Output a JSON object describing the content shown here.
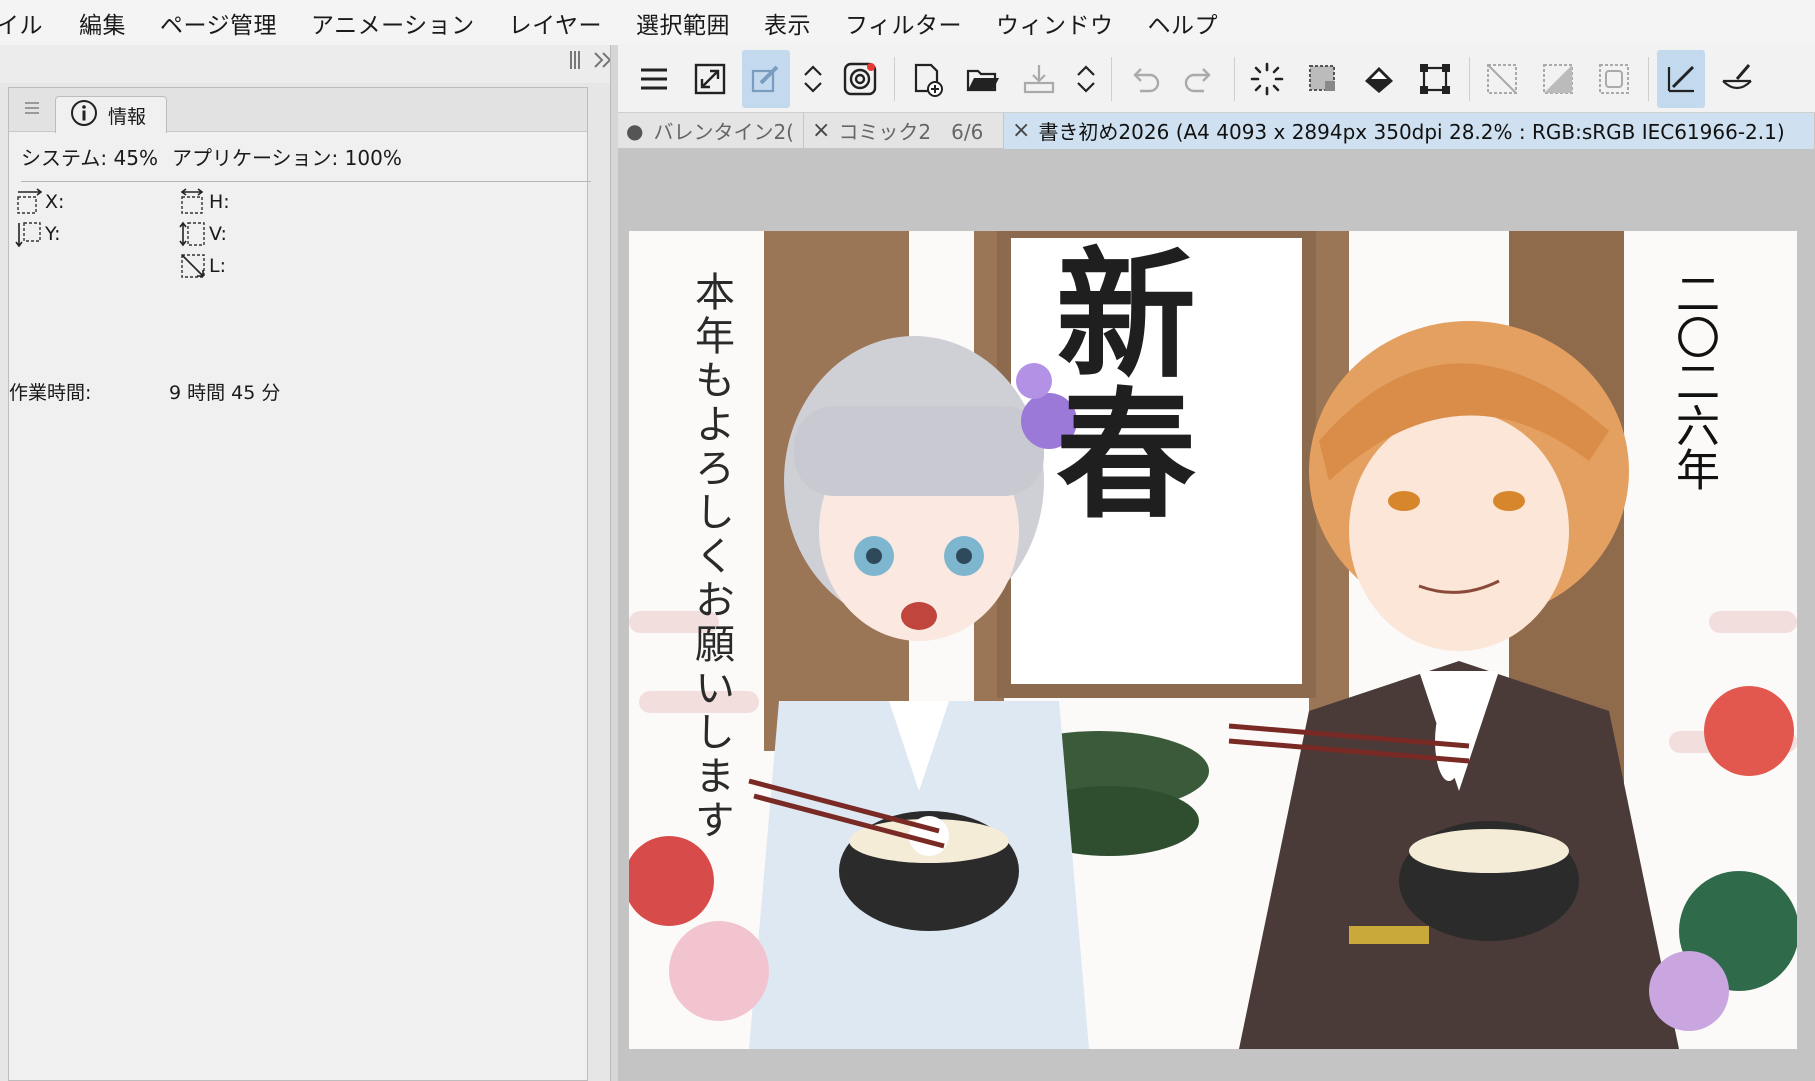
{
  "menu": {
    "items": [
      "イル",
      "編集",
      "ページ管理",
      "アニメーション",
      "レイヤー",
      "選択範囲",
      "表示",
      "フィルター",
      "ウィンドウ",
      "ヘルプ"
    ]
  },
  "info_panel": {
    "tab_label": "情報",
    "system_usage": "システム: 45%",
    "app_usage": "アプリケーション: 100%",
    "x_label": "X:",
    "y_label": "Y:",
    "h_label": "H:",
    "v_label": "V:",
    "l_label": "L:",
    "work_time_label": "作業時間:",
    "work_time_value": "9 時間 45 分"
  },
  "toolbar": {
    "icons": [
      "menu-icon",
      "fit-to-window-icon",
      "edit-icon",
      "stepper-icon",
      "spiral-icon",
      "new-canvas-icon",
      "open-folder-icon",
      "save-icon",
      "stepper-icon",
      "undo-icon",
      "redo-icon",
      "loading-icon",
      "select-all-icon",
      "fill-bucket-icon",
      "transform-icon",
      "deselect-icon",
      "invert-selection-icon",
      "show-selection-icon",
      "pen-icon",
      "brush-icon"
    ]
  },
  "doc_tabs": [
    {
      "label": "バレンタイン2(",
      "state": "modified"
    },
    {
      "label": "コミック2　6/6",
      "state": "normal"
    },
    {
      "label": "書き初め2026 (A4 4093 x 2894px 350dpi 28.2% : RGB:sRGB IEC61966-2.1)",
      "state": "active"
    }
  ],
  "artwork": {
    "left_text": "本年もよろしくお願いします",
    "center_text": "新春",
    "right_text": "二〇二六年"
  },
  "colors": {
    "accent": "#c3d9ee",
    "active_tab": "#cfe0f0",
    "canvas_bg": "#c4c4c4"
  }
}
